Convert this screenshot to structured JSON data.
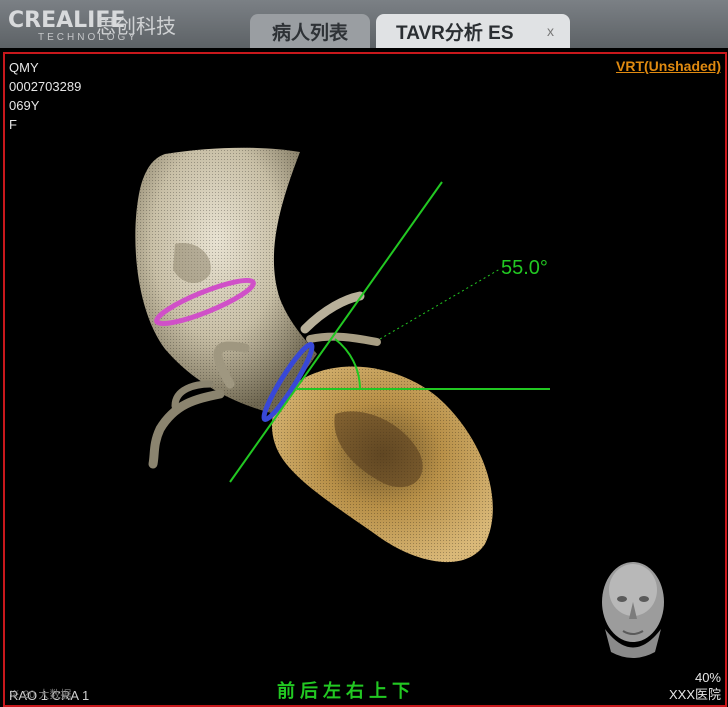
{
  "app": {
    "logo_text": "CREALIFE",
    "logo_cn": "思创科技",
    "logo_sub": "TECHNOLOGY"
  },
  "tabs": [
    {
      "label": "病人列表"
    },
    {
      "label": "TAVR分析 ES",
      "close": "x"
    }
  ],
  "patient": {
    "name": "QMY",
    "id": "0002703289",
    "age": "069Y",
    "sex": "F"
  },
  "view": {
    "render_mode": "VRT(Unshaded)",
    "angle_label": "55.0°",
    "directions": [
      "前",
      "后",
      "左",
      "右",
      "上",
      "下"
    ],
    "zoom": "40%",
    "hospital": "XXX医院",
    "orientation": "RAO 1  CRA 1",
    "orientation_overlay": "※ 20 大数据"
  },
  "colors": {
    "accent_green": "#22c822",
    "tab_active": "#e0e2e4",
    "border_red": "#c8181c",
    "mode_orange": "#e08a10"
  }
}
